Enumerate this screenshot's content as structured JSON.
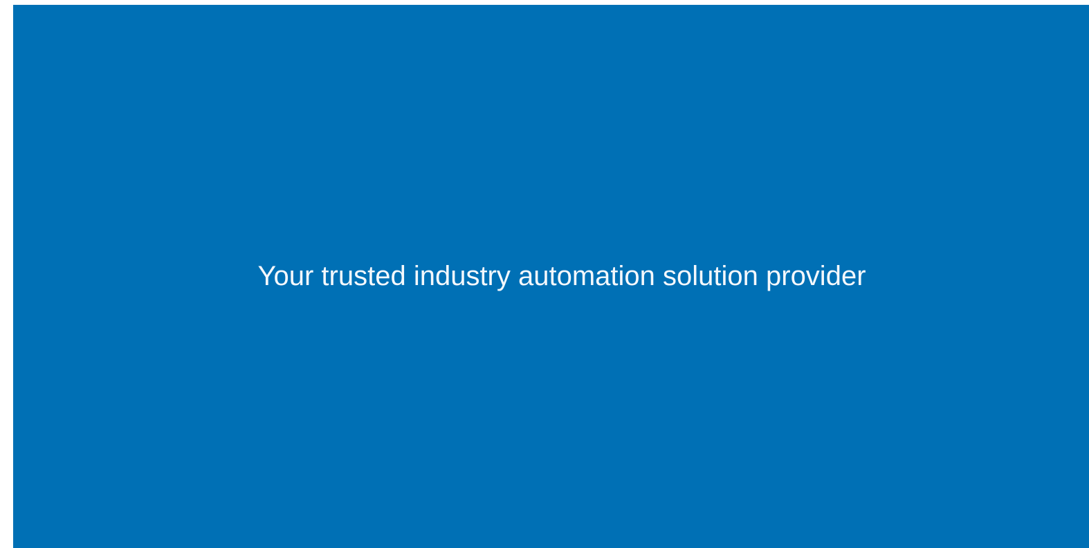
{
  "hero": {
    "tagline": "Your trusted industry automation solution provider",
    "background_color": "#0070b5",
    "text_color": "#f4f8fc"
  }
}
